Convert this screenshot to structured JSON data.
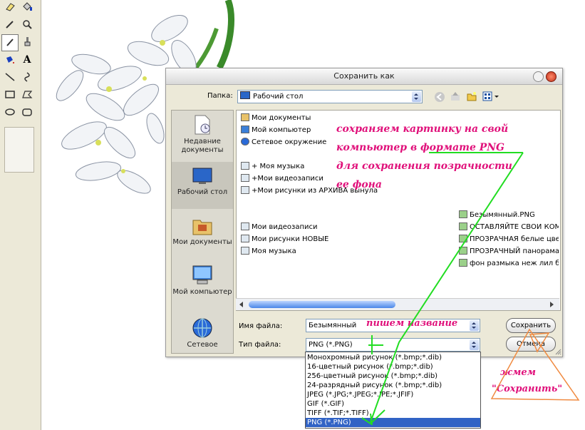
{
  "dialog": {
    "title": "Сохранить как",
    "folder_label": "Папка:",
    "folder_value": "Рабочий стол",
    "filename_label": "Имя файла:",
    "filename_value": "Безымянный",
    "filetype_label": "Тип файла:",
    "filetype_value": "PNG (*.PNG)",
    "save_button": "Сохранить",
    "cancel_button": "Отмена"
  },
  "places": [
    {
      "label": "Недавние документы",
      "icon": "recent-documents-icon"
    },
    {
      "label": "Рабочий стол",
      "icon": "desktop-icon"
    },
    {
      "label": "Мои документы",
      "icon": "my-documents-icon"
    },
    {
      "label": "Мой компьютер",
      "icon": "my-computer-icon"
    },
    {
      "label": "Сетевое",
      "icon": "network-icon"
    }
  ],
  "files_left": [
    "Мои документы",
    "Мой компьютер",
    "Сетевое окружение",
    "+ Моя музыка",
    "+Мои видеозаписи",
    "+Мои рисунки из АРХИВА вынула",
    "Мои видеозаписи",
    "Мои рисунки НОВЫЕ",
    "Моя музыка"
  ],
  "files_right": [
    "Безымянный.PNG",
    "ОСТАВЛЯЙТЕ СВОИ КОМ",
    "ПРОЗРАЧНАЯ белые цве",
    "ПРОЗРАЧНЫЙ панорама",
    "фон размыка неж лил б"
  ],
  "filetype_options": [
    "Монохромный рисунок (*.bmp;*.dib)",
    "16-цветный рисунок (*.bmp;*.dib)",
    "256-цветный рисунок (*.bmp;*.dib)",
    "24-разрядный рисунок (*.bmp;*.dib)",
    "JPEG (*.JPG;*.JPEG;*.JPE;*.JFIF)",
    "GIF (*.GIF)",
    "TIFF (*.TIF;*.TIFF)",
    "PNG (*.PNG)"
  ],
  "annotations": {
    "note_lines": [
      "сохраняем картинку на свой",
      "компьютер в формате PNG",
      "для сохранения позрачности",
      "ее фона"
    ],
    "name_hint": "пишем название",
    "press_line1": "жмем",
    "press_line2": "\"Сохранить\""
  },
  "colors": {
    "annotation_text": "#e0107a",
    "annotation_arrow": "#22dd22",
    "triangle": "#f08a40",
    "selection": "#3163c5"
  }
}
